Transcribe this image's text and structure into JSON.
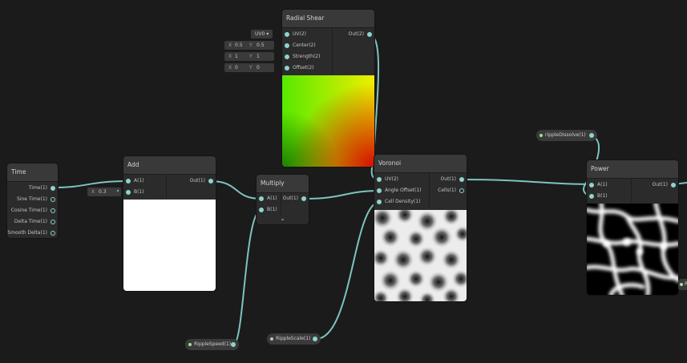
{
  "nodes": {
    "time": {
      "title": "Time",
      "outputs": [
        "Time(1)",
        "Sine Time(1)",
        "Cosine Time(1)",
        "Delta Time(1)",
        "Smooth Delta(1)"
      ]
    },
    "add": {
      "title": "Add",
      "inputs": [
        "A(1)",
        "B(1)"
      ],
      "output": "Out(1)",
      "b_field": {
        "label": "X",
        "value": "0.3"
      }
    },
    "multiply": {
      "title": "Multiply",
      "inputs": [
        "A(1)",
        "B(1)"
      ],
      "output": "Out(1)",
      "expand_glyph": "⌄"
    },
    "radial_shear": {
      "title": "Radial Shear",
      "inputs": [
        "UV(2)",
        "Center(2)",
        "Strength(2)",
        "Offset(2)"
      ],
      "output": "Out(2)",
      "uv_dropdown": "UV0 ▾",
      "center": {
        "x_label": "X",
        "x": "0.5",
        "y_label": "Y",
        "y": "0.5"
      },
      "strength": {
        "x_label": "X",
        "x": "1",
        "y_label": "Y",
        "y": "1"
      },
      "offset": {
        "x_label": "X",
        "x": "0",
        "y_label": "Y",
        "y": "0"
      }
    },
    "voronoi": {
      "title": "Voronoi",
      "inputs": [
        "UV(2)",
        "Angle Offset(1)",
        "Cell Density(1)"
      ],
      "outputs": [
        "Out(1)",
        "Cells(1)"
      ]
    },
    "power": {
      "title": "Power",
      "inputs": [
        "A(1)",
        "B(1)"
      ],
      "output": "Out(1)"
    }
  },
  "properties": {
    "ripple_dissolve": "rippleDissolve(1)",
    "ripple_speed": "RippleSpeed(1)",
    "ripple_scale": "RippleScale(1)",
    "offscreen_label": "R"
  },
  "colors": {
    "canvas": "#1b1b1b",
    "node_body": "#2b2b2b",
    "node_header": "#393939",
    "edge": "#8fd3ce",
    "port": "#8fd3ce",
    "property_dot": "#a8d8a0"
  }
}
